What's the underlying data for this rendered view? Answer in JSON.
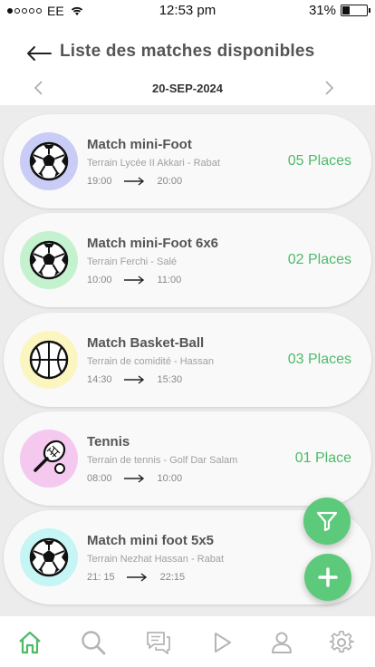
{
  "status_bar": {
    "carrier": "EE",
    "time": "12:53 pm",
    "battery": "31%"
  },
  "header": {
    "title": "Liste des matches disponibles",
    "back_icon": "arrow-left-icon"
  },
  "date_nav": {
    "date": "20-SEP-2024",
    "prev_icon": "chevron-left-icon",
    "next_icon": "chevron-right-icon"
  },
  "matches": [
    {
      "title": "Match mini-Foot",
      "venue": "Terrain Lycée II Akkari - Rabat",
      "start": "19:00",
      "end": "20:00",
      "places": "05 Places",
      "icon": "soccer-ball-icon",
      "icon_bg": "#c9cdf5"
    },
    {
      "title": "Match mini-Foot 6x6",
      "venue": "Terrain Ferchi - Salé",
      "start": "10:00",
      "end": "11:00",
      "places": "02 Places",
      "icon": "soccer-ball-icon",
      "icon_bg": "#c4f2cf"
    },
    {
      "title": "Match Basket-Ball",
      "venue": "Terrain de comidité - Hassan",
      "start": "14:30",
      "end": "15:30",
      "places": "03 Places",
      "icon": "basketball-icon",
      "icon_bg": "#fbf6c0"
    },
    {
      "title": "Tennis",
      "venue": "Terrain de tennis - Golf Dar Salam",
      "start": "08:00",
      "end": "10:00",
      "places": "01 Place",
      "icon": "tennis-icon",
      "icon_bg": "#f5c8f0"
    },
    {
      "title": "Match mini foot 5x5",
      "venue": "Terrain Nezhat Hassan - Rabat",
      "start": "21: 15",
      "end": "22:15",
      "places": "",
      "icon": "soccer-ball-icon",
      "icon_bg": "#c6f5f6"
    }
  ],
  "fabs": {
    "filter_icon": "filter-icon",
    "add_icon": "plus-icon",
    "color": "#5dc97a"
  },
  "tabs": [
    {
      "icon": "home-icon",
      "active": true
    },
    {
      "icon": "search-icon",
      "active": false
    },
    {
      "icon": "chat-icon",
      "active": false
    },
    {
      "icon": "play-icon",
      "active": false
    },
    {
      "icon": "user-icon",
      "active": false
    },
    {
      "icon": "gear-icon",
      "active": false
    }
  ],
  "colors": {
    "accent": "#4cbb68",
    "active_tab": "#4cbb68",
    "inactive_tab": "#b5b5b5"
  }
}
